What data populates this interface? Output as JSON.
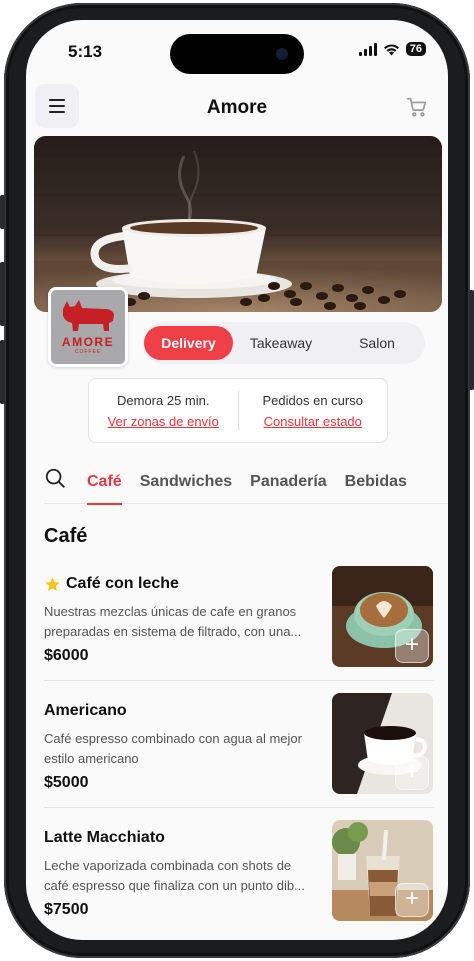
{
  "status": {
    "time": "5:13",
    "battery": "76"
  },
  "header": {
    "title": "Amore",
    "menu_icon": "hamburger-icon",
    "cart_icon": "cart-icon"
  },
  "brand": {
    "logo_text": "AMORE",
    "logo_sub": "COFFEE",
    "accent_color": "#ef3f47"
  },
  "order_modes": [
    {
      "label": "Delivery",
      "active": true
    },
    {
      "label": "Takeaway",
      "active": false
    },
    {
      "label": "Salon",
      "active": false
    }
  ],
  "info": {
    "delay_label": "Demora 25 min.",
    "delay_link": "Ver zonas de envío",
    "orders_label": "Pedidos en curso",
    "orders_link": "Consultar estado"
  },
  "categories": [
    {
      "label": "Café",
      "active": true
    },
    {
      "label": "Sandwiches",
      "active": false
    },
    {
      "label": "Panadería",
      "active": false
    },
    {
      "label": "Bebidas",
      "active": false
    }
  ],
  "section_title": "Café",
  "products": [
    {
      "name": "Café con leche",
      "featured": true,
      "desc_line1": "Nuestras mezclas únicas de cafe en granos",
      "desc_line2": "preparadas en sistema de filtrado, con una...",
      "price": "$6000",
      "add_label": "+"
    },
    {
      "name": "Americano",
      "featured": false,
      "desc_line1": "Café espresso combinado con agua al mejor",
      "desc_line2": "estilo americano",
      "price": "$5000",
      "add_label": "+"
    },
    {
      "name": "Latte Macchiato",
      "featured": false,
      "desc_line1": "Leche vaporizada combinada con shots de",
      "desc_line2": "café espresso que finaliza con un punto dib...",
      "price": "$7500",
      "add_label": "+"
    }
  ]
}
